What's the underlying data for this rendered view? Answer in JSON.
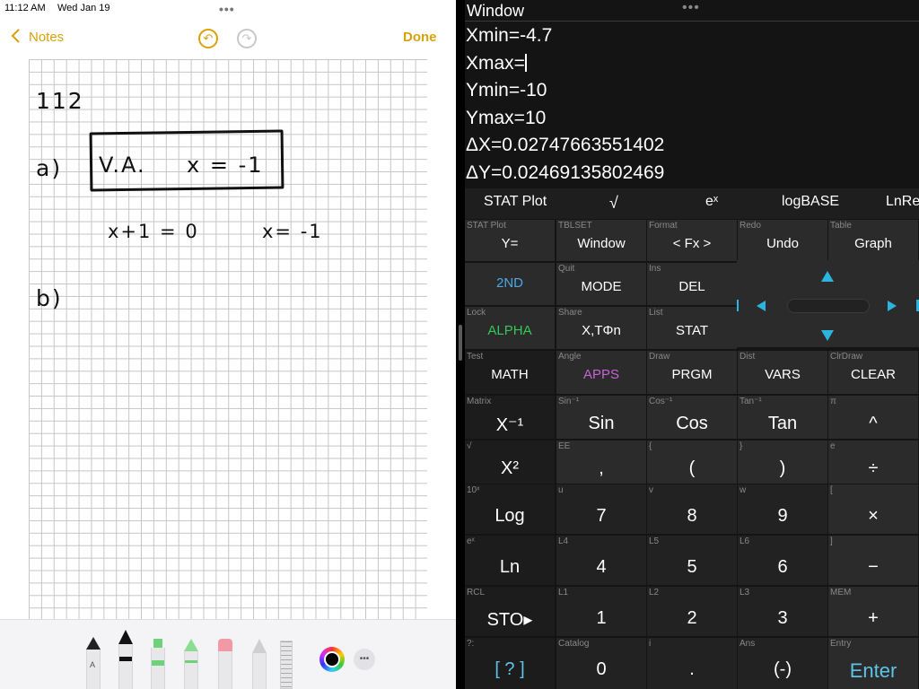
{
  "status_bar": {
    "time": "11:12 AM",
    "date": "Wed Jan 19"
  },
  "notes": {
    "back_label": "Notes",
    "done_label": "Done",
    "handwriting": {
      "problem": "112",
      "part_a": "a)",
      "va_label": "V.A.",
      "va_result": "x = -1",
      "equation": "x+1 = 0",
      "solution": "x= -1",
      "part_b": "b)"
    },
    "tools": [
      "pen",
      "marker",
      "highlighter-green",
      "pencil-green",
      "eraser",
      "lasso",
      "ruler",
      "color-picker",
      "more"
    ]
  },
  "calculator": {
    "window_title": "Window",
    "window_values": [
      {
        "name": "xmin",
        "text": "Xmin=-4.7"
      },
      {
        "name": "xmax",
        "text": "Xmax="
      },
      {
        "name": "ymin",
        "text": "Ymin=-10"
      },
      {
        "name": "ymax",
        "text": "Ymax=10"
      },
      {
        "name": "deltax",
        "text": "ΔX=0.02747663551402"
      },
      {
        "name": "deltay",
        "text": "ΔY=0.02469135802469"
      }
    ],
    "function_row": [
      "STAT Plot",
      "√",
      "eˣ",
      "logBASE",
      "LnRe"
    ],
    "colors": {
      "second": "#4aa9e8",
      "alpha": "#35c759",
      "apps": "#c862d8",
      "arrows": "#2bb4e0",
      "enter": "#5dc4e8"
    },
    "keys": [
      {
        "id": "y-equals",
        "second": "STAT Plot",
        "label": "Y="
      },
      {
        "id": "window",
        "second": "TBLSET",
        "label": "Window"
      },
      {
        "id": "format",
        "second": "Format",
        "label": "< Fx >"
      },
      {
        "id": "undo",
        "second": "Redo",
        "label": "Undo"
      },
      {
        "id": "graph",
        "second": "Table",
        "label": "Graph"
      },
      {
        "id": "2nd",
        "second": "",
        "label": "2ND"
      },
      {
        "id": "mode",
        "second": "Quit",
        "label": "MODE"
      },
      {
        "id": "del",
        "second": "Ins",
        "label": "DEL"
      },
      {
        "id": "alpha",
        "second": "Lock",
        "label": "ALPHA"
      },
      {
        "id": "xttheta",
        "second": "Share",
        "label": "X,TΦn"
      },
      {
        "id": "stat",
        "second": "List",
        "label": "STAT"
      },
      {
        "id": "math",
        "second": "Test",
        "label": "MATH"
      },
      {
        "id": "apps",
        "second": "Angle",
        "label": "APPS"
      },
      {
        "id": "prgm",
        "second": "Draw",
        "label": "PRGM"
      },
      {
        "id": "vars",
        "second": "Dist",
        "label": "VARS"
      },
      {
        "id": "clear",
        "second": "ClrDraw",
        "label": "CLEAR"
      },
      {
        "id": "inverse",
        "second": "Matrix",
        "label": "X⁻¹"
      },
      {
        "id": "sin",
        "second": "Sin⁻¹",
        "label": "Sin"
      },
      {
        "id": "cos",
        "second": "Cos⁻¹",
        "label": "Cos"
      },
      {
        "id": "tan",
        "second": "Tan⁻¹",
        "label": "Tan"
      },
      {
        "id": "power",
        "second": "π",
        "label": "^"
      },
      {
        "id": "square",
        "second": "√",
        "label": "X²"
      },
      {
        "id": "comma",
        "second": "EE",
        "label": ","
      },
      {
        "id": "lparen",
        "second": "{",
        "label": "("
      },
      {
        "id": "rparen",
        "second": "}",
        "label": ")"
      },
      {
        "id": "divide",
        "second": "e",
        "label": "÷"
      },
      {
        "id": "log",
        "second": "10ˣ",
        "label": "Log"
      },
      {
        "id": "seven",
        "second": "u",
        "label": "7"
      },
      {
        "id": "eight",
        "second": "v",
        "label": "8"
      },
      {
        "id": "nine",
        "second": "w",
        "label": "9"
      },
      {
        "id": "multiply",
        "second": "[",
        "label": "×"
      },
      {
        "id": "ln",
        "second": "eˣ",
        "label": "Ln"
      },
      {
        "id": "four",
        "second": "L4",
        "label": "4"
      },
      {
        "id": "five",
        "second": "L5",
        "label": "5"
      },
      {
        "id": "six",
        "second": "L6",
        "label": "6"
      },
      {
        "id": "minus",
        "second": "]",
        "label": "−"
      },
      {
        "id": "sto",
        "second": "RCL",
        "label": "STO▸"
      },
      {
        "id": "one",
        "second": "L1",
        "label": "1"
      },
      {
        "id": "two",
        "second": "L2",
        "label": "2"
      },
      {
        "id": "three",
        "second": "L3",
        "label": "3"
      },
      {
        "id": "plus",
        "second": "MEM",
        "label": "+"
      },
      {
        "id": "help",
        "second": "?:",
        "label": "[ ? ]"
      },
      {
        "id": "zero",
        "second": "Catalog",
        "label": "0"
      },
      {
        "id": "decimal",
        "second": "i",
        "label": "."
      },
      {
        "id": "negative",
        "second": "Ans",
        "label": "(-)"
      },
      {
        "id": "enter",
        "second": "Entry",
        "label": "Enter"
      }
    ]
  }
}
